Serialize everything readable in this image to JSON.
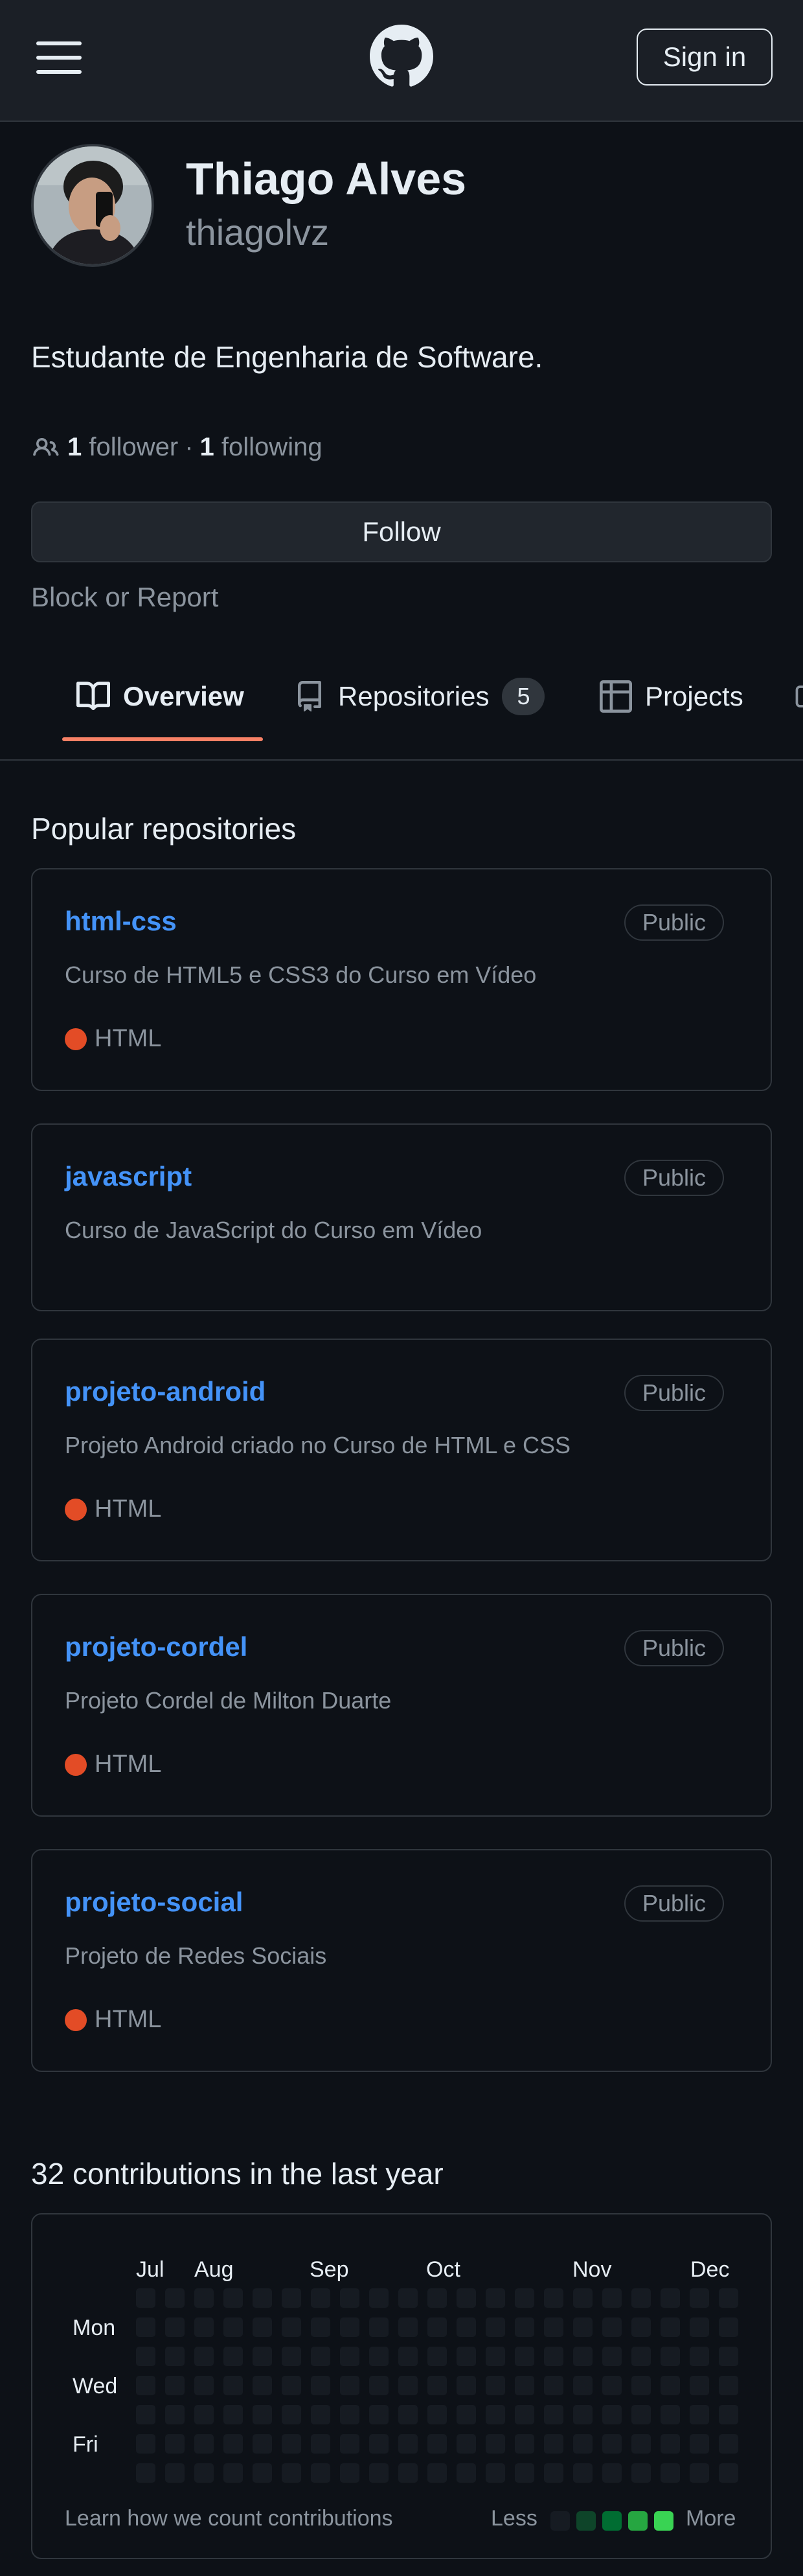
{
  "header": {
    "signin_label": "Sign in"
  },
  "profile": {
    "name": "Thiago Alves",
    "login": "thiagolvz",
    "bio": "Estudante de Engenharia de Software.",
    "followers_count": "1",
    "followers_label": "follower",
    "separator": "·",
    "following_count": "1",
    "following_label": "following",
    "follow_button": "Follow",
    "block_report": "Block or Report"
  },
  "tabs": {
    "overview": "Overview",
    "repositories": "Repositories",
    "repositories_count": "5",
    "projects": "Projects"
  },
  "popular": {
    "title": "Popular repositories",
    "repos": [
      {
        "name": "html-css",
        "visibility": "Public",
        "description": "Curso de HTML5 e CSS3 do Curso em Vídeo",
        "language": "HTML"
      },
      {
        "name": "javascript",
        "visibility": "Public",
        "description": "Curso de JavaScript do Curso em Vídeo",
        "language": ""
      },
      {
        "name": "projeto-android",
        "visibility": "Public",
        "description": "Projeto Android criado no Curso de HTML e CSS",
        "language": "HTML"
      },
      {
        "name": "projeto-cordel",
        "visibility": "Public",
        "description": "Projeto Cordel de Milton Duarte",
        "language": "HTML"
      },
      {
        "name": "projeto-social",
        "visibility": "Public",
        "description": "Projeto de Redes Sociais",
        "language": "HTML"
      }
    ]
  },
  "contributions": {
    "title": "32 contributions in the last year",
    "months": [
      "Jul",
      "Aug",
      "Sep",
      "Oct",
      "Nov",
      "Dec"
    ],
    "days": [
      "Mon",
      "Wed",
      "Fri"
    ],
    "learn_link": "Learn how we count contributions",
    "legend_less": "Less",
    "legend_more": "More",
    "level_colors": [
      "#161b22",
      "#0e4429",
      "#006d32",
      "#26a641",
      "#39d353"
    ]
  },
  "colors": {
    "background": "#0d1117",
    "link": "#4493f8",
    "html_language": "#e34c26",
    "tab_underline": "#f78166"
  }
}
